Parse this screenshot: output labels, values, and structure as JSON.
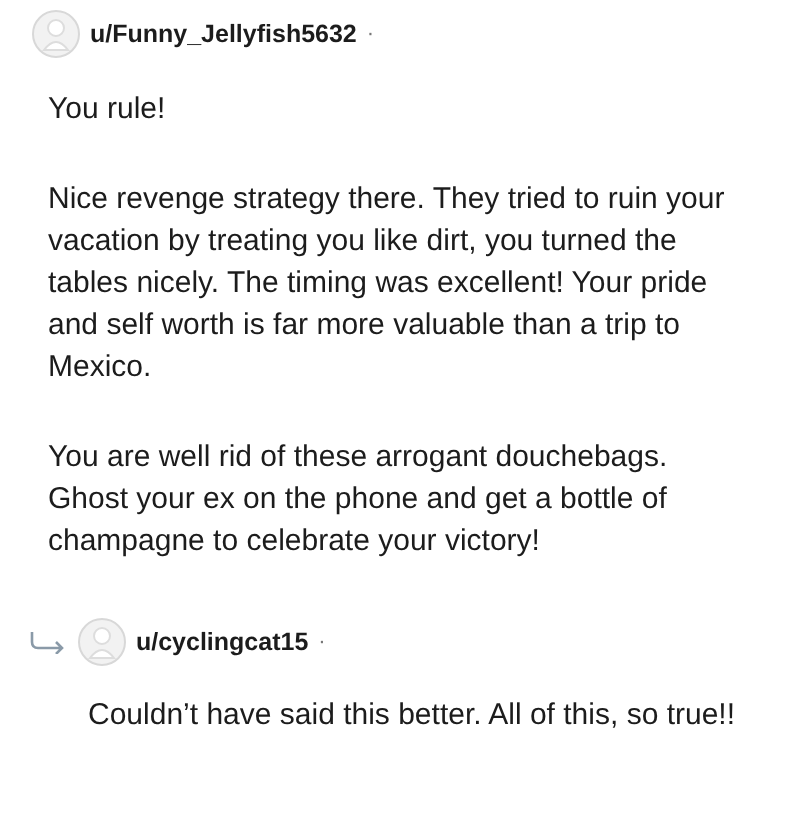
{
  "comments": [
    {
      "username": "u/Funny_Jellyfish5632",
      "separator": "·",
      "reply": false,
      "paragraphs": [
        "You rule!",
        "Nice revenge strategy there. They tried to ruin your vacation by treating you like dirt, you turned the tables nicely. The timing was excellent! Your pride and self worth is far more valuable than a trip to Mexico.",
        "You are well rid of these arrogant douchebags. Ghost your ex on the phone and get a bottle of champagne to celebrate your victory!"
      ]
    },
    {
      "username": "u/cyclingcat15",
      "separator": "·",
      "reply": true,
      "paragraphs": [
        "Couldn’t have said this better. All of this, so true!!"
      ]
    }
  ]
}
